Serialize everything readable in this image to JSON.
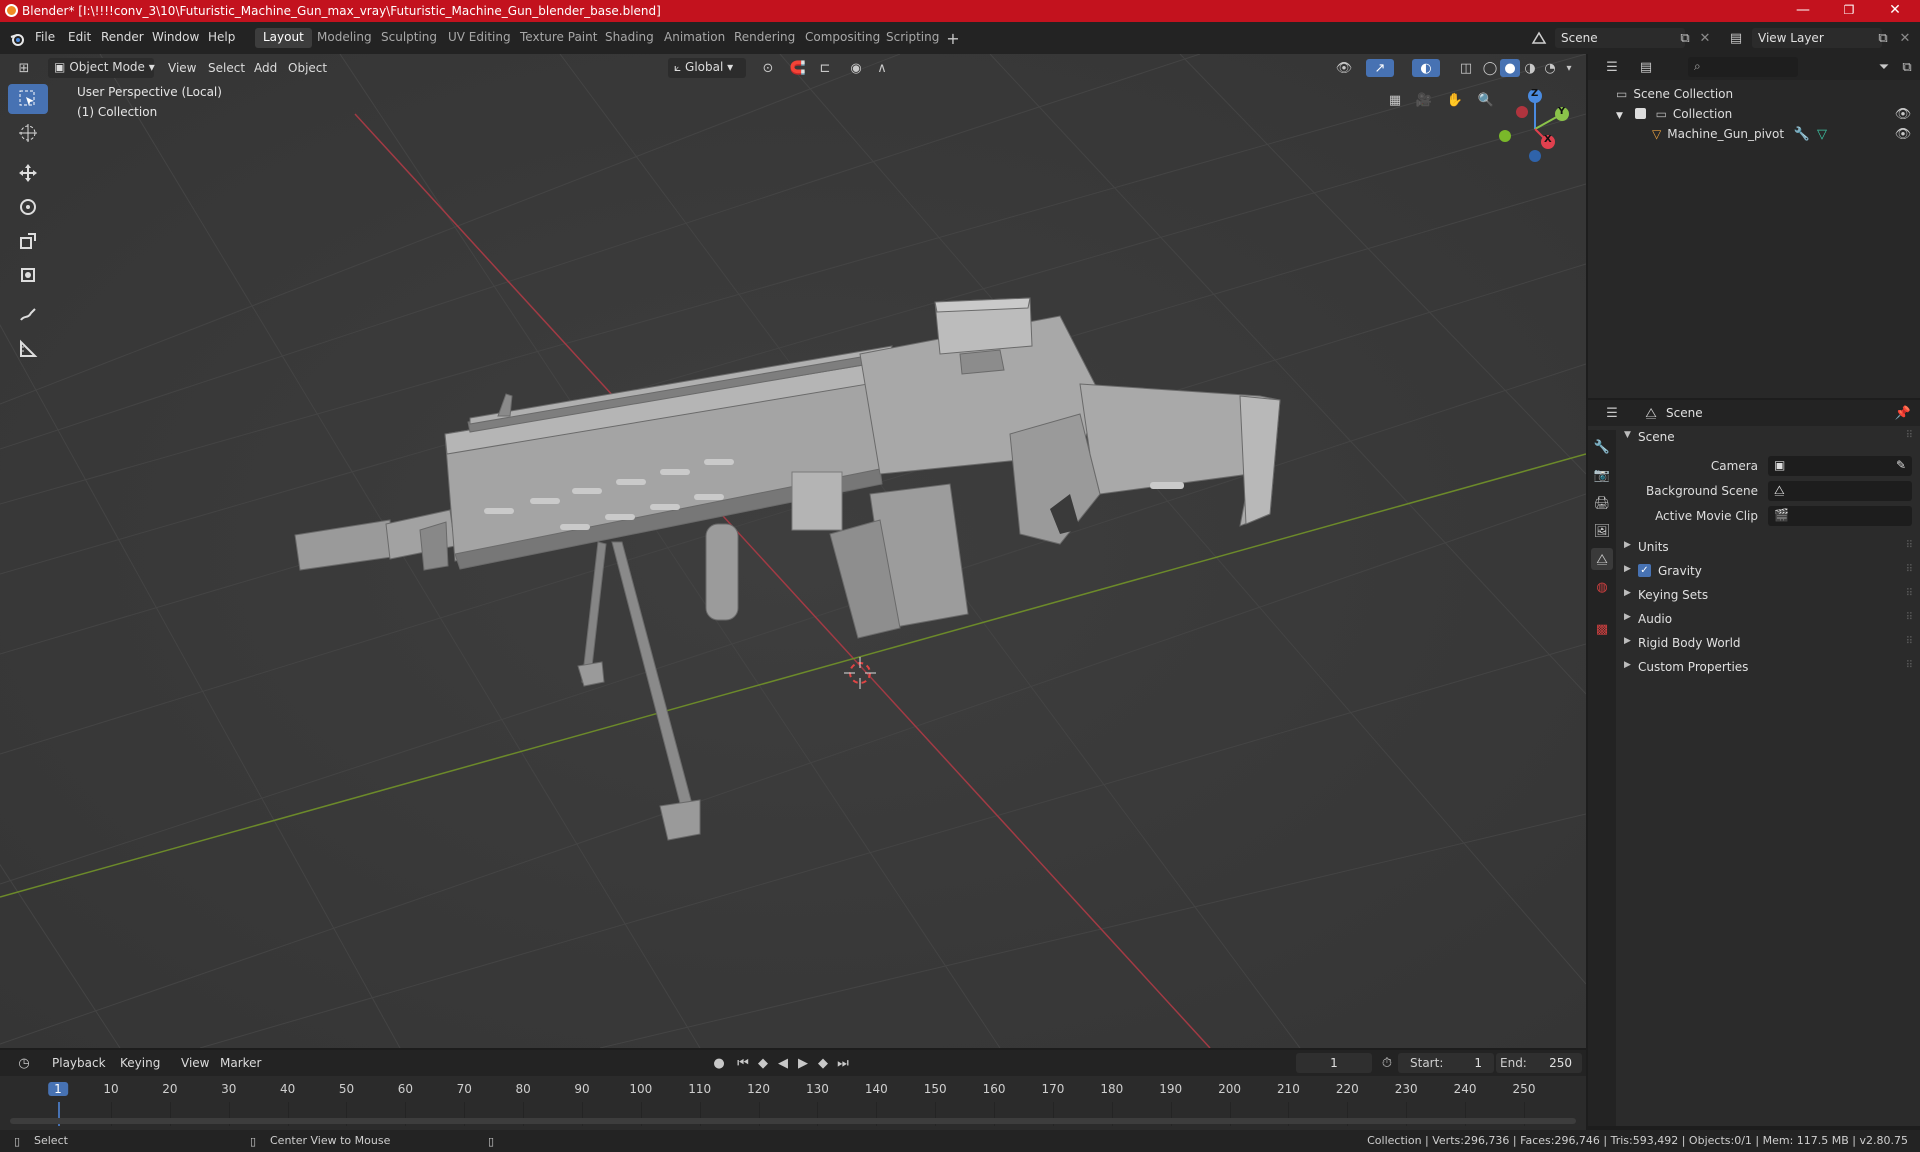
{
  "window": {
    "title": "Blender* [I:\\!!!!conv_3\\10\\Futuristic_Machine_Gun_max_vray\\Futuristic_Machine_Gun_blender_base.blend]",
    "minimize": "—",
    "restore": "❐",
    "close": "✕"
  },
  "menu": [
    "File",
    "Edit",
    "Render",
    "Window",
    "Help"
  ],
  "workspaces": [
    "Layout",
    "Modeling",
    "Sculpting",
    "UV Editing",
    "Texture Paint",
    "Shading",
    "Animation",
    "Rendering",
    "Compositing",
    "Scripting"
  ],
  "scene_selector": "Scene",
  "view_layer": "View Layer",
  "viewport_header": {
    "mode": "Object Mode",
    "menus": [
      "View",
      "Select",
      "Add",
      "Object"
    ],
    "transform_orientation": "Global"
  },
  "viewport_info": {
    "line1": "User Perspective (Local)",
    "line2": "(1) Collection"
  },
  "gizmo": {
    "z": "Z",
    "y": "Y",
    "x": "X"
  },
  "outliner": {
    "root": "Scene Collection",
    "collection": "Collection",
    "object": "Machine_Gun_pivot"
  },
  "properties": {
    "context": "Scene",
    "section": "Scene",
    "camera_label": "Camera",
    "background_label": "Background Scene",
    "movie_clip_label": "Active Movie Clip",
    "panels": [
      "Units",
      "Gravity",
      "Keying Sets",
      "Audio",
      "Rigid Body World",
      "Custom Properties"
    ]
  },
  "timeline": {
    "menus": [
      "Playback",
      "Keying",
      "View",
      "Marker"
    ],
    "current_frame": "1",
    "start_label": "Start:",
    "start": "1",
    "end_label": "End:",
    "end": "250",
    "ticks": [
      "1",
      "10",
      "20",
      "30",
      "40",
      "50",
      "60",
      "70",
      "80",
      "90",
      "100",
      "110",
      "120",
      "130",
      "140",
      "150",
      "160",
      "170",
      "180",
      "190",
      "200",
      "210",
      "220",
      "230",
      "240",
      "250"
    ]
  },
  "statusbar": {
    "left": "Select",
    "middle": "Center View to Mouse",
    "right": "Collection | Verts:296,736 | Faces:296,746 | Tris:593,492 | Objects:0/1 | Mem: 117.5 MB | v2.80.75"
  },
  "colors": {
    "titlebar": "#c3121e",
    "accent": "#4772b3",
    "x_axis": "#e0404e",
    "y_axis": "#8bc34a",
    "z_axis": "#4a8be0",
    "viewport": "#3a3a3a"
  }
}
